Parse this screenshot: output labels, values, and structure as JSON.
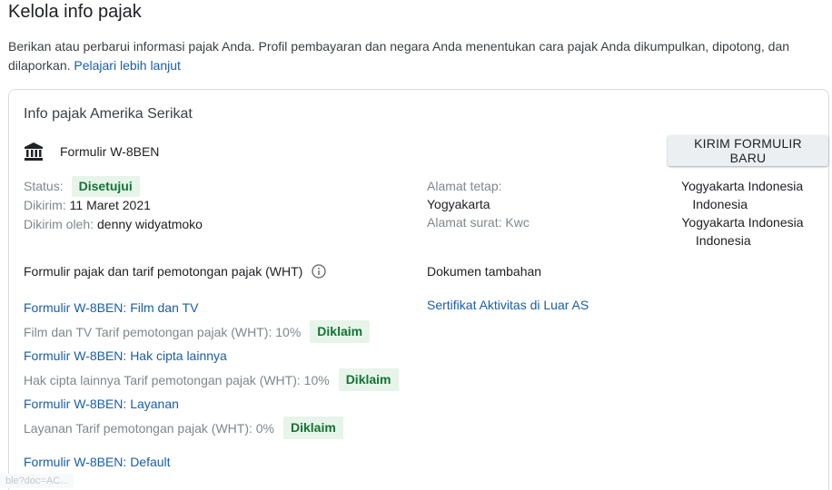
{
  "page": {
    "title": "Kelola info pajak",
    "intro_text": "Berikan atau perbarui informasi pajak Anda. Profil pembayaran dan negara Anda menentukan cara pajak Anda dikumpulkan, dipotong, dan dilaporkan.",
    "learn_more": "Pelajari lebih lanjut"
  },
  "card": {
    "title": "Info pajak Amerika Serikat",
    "form_name": "Formulir W-8BEN",
    "send_button": "KIRIM FORMULIR BARU",
    "status_label": "Status:",
    "status_value": "Disetujui",
    "sent_label": "Dikirim:",
    "sent_value": "11 Maret 2021",
    "sent_by_label": "Dikirim oleh:",
    "sent_by_value": "denny widyatmoko",
    "address": {
      "permanent_label": "Alamat tetap:",
      "permanent_line1_visible": "Yogyakarta Indonesia",
      "permanent_line2_start": "Yogyakarta",
      "permanent_line2_end": "Indonesia",
      "mailing_label": "Alamat surat:",
      "mailing_line1_start": "Kwc",
      "mailing_line1_visible": "Yogyakarta Indonesia",
      "mailing_line2_end": "Indonesia"
    },
    "wht_section_title": "Formulir pajak dan tarif pemotongan pajak (WHT)",
    "wht_items": [
      {
        "link": "Formulir W-8BEN: Film dan TV",
        "rate_text": "Film dan TV Tarif pemotongan pajak (WHT): 10%",
        "badge": "Diklaim"
      },
      {
        "link": "Formulir W-8BEN: Hak cipta lainnya",
        "rate_text": "Hak cipta lainnya Tarif pemotongan pajak (WHT): 10%",
        "badge": "Diklaim"
      },
      {
        "link": "Formulir W-8BEN: Layanan",
        "rate_text": "Layanan Tarif pemotongan pajak (WHT): 0%",
        "badge": "Diklaim"
      }
    ],
    "default_link": "Formulir W-8BEN: Default",
    "docs_title": "Dokumen tambahan",
    "docs_link": "Sertifikat Aktivitas di Luar AS"
  },
  "status_bar": {
    "url": "ble?doc=AC..."
  },
  "icons": {
    "bank": "bank-icon",
    "info": "info-icon"
  },
  "colors": {
    "link": "#1a5ea8",
    "badge_bg": "#e6f4ea",
    "badge_text": "#137333"
  }
}
